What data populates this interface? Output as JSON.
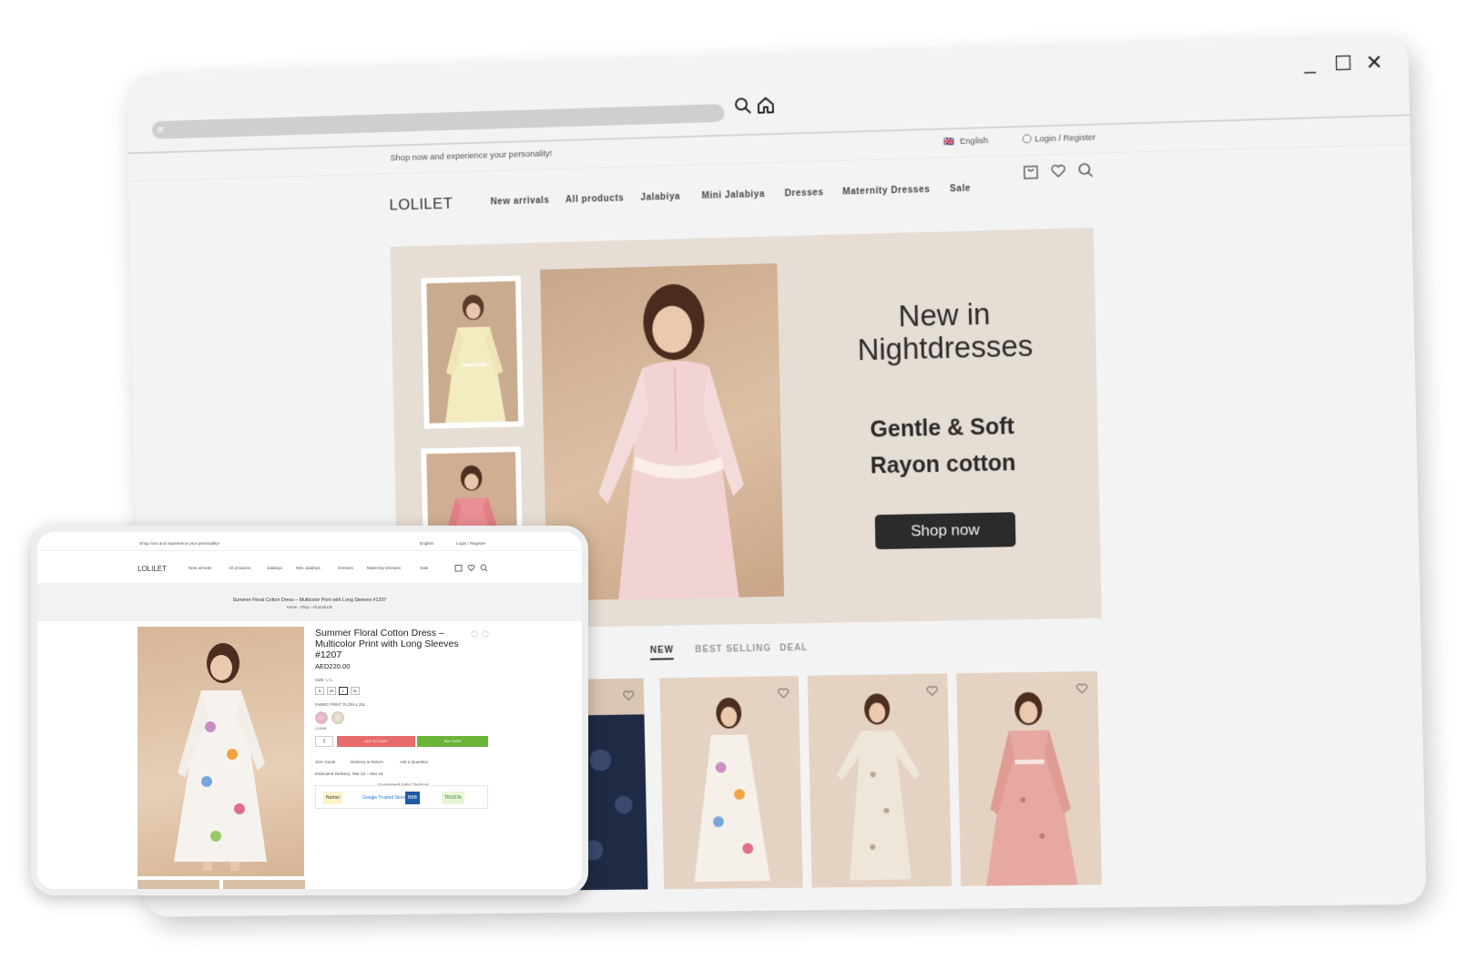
{
  "browser": {
    "window_controls": {
      "minimize": "_",
      "maximize": "☐",
      "close": "✕"
    },
    "address_icon": "≡",
    "topbar": {
      "promo": "Shop now and experience your personality!",
      "language": "English",
      "flag": "🇬🇧",
      "login": "Login / Register"
    },
    "nav": {
      "logo": "LOLILET",
      "items": [
        "New arrivals",
        "All products",
        "Jalabiya",
        "Mini Jalabiya",
        "Dresses",
        "Maternity Dresses",
        "Sale"
      ]
    },
    "hero": {
      "title_line1": "New in",
      "title_line2": "Nightdresses",
      "subtitle_line1": "Gentle & Soft",
      "subtitle_line2": "Rayon cotton",
      "cta": "Shop now"
    },
    "tabs": [
      "NEW",
      "BEST SELLING",
      "DEAL"
    ],
    "products": [
      {
        "colors": [
          "#1f2b44",
          "#3a4a6e"
        ]
      },
      {
        "colors": [
          "#f5f1ea",
          "#c98fc4"
        ]
      },
      {
        "colors": [
          "#efe6da",
          "#b9a48d"
        ]
      },
      {
        "colors": [
          "#e6a8a0",
          "#c77b76"
        ]
      }
    ]
  },
  "tablet": {
    "topbar": {
      "promo": "Shop now and experience your personality!",
      "language": "English",
      "login": "Login / Register"
    },
    "nav": {
      "logo": "LOLILET",
      "items": [
        "New arrivals",
        "All products",
        "Jalabiya",
        "Mini Jalabiya",
        "Dresses",
        "Maternity Dresses",
        "Sale"
      ]
    },
    "banner": {
      "title": "Summer Floral Cotton Dress – Multicolor Print with Long Sleeves #1207",
      "breadcrumb": "Home  ›  Shop  ›  All products"
    },
    "product": {
      "title": "Summer Floral Cotton Dress – Multicolor Print with Long Sleeves #1207",
      "price": "AED220.00",
      "size_label": "SIZE: L / L",
      "sizes": [
        "S",
        "M",
        "L",
        "XL"
      ],
      "selected_size": "L",
      "fabric_label": "FABRIC PRINT: FLORAL 251",
      "clear": "CLEAR",
      "quantity": "1",
      "add_to_cart": "ADD TO CART",
      "buy_now": "BUY NOW",
      "links": [
        "Size Guide",
        "Delivery & Return",
        "Ask a Question"
      ],
      "delivery": "Estimated Delivery: Mar 22 – Mar 24",
      "safe_checkout": "Guaranteed Safe Checkout",
      "badges": [
        "Norton",
        "Google Trusted Store",
        "BBB",
        "TRUSTe"
      ]
    }
  }
}
